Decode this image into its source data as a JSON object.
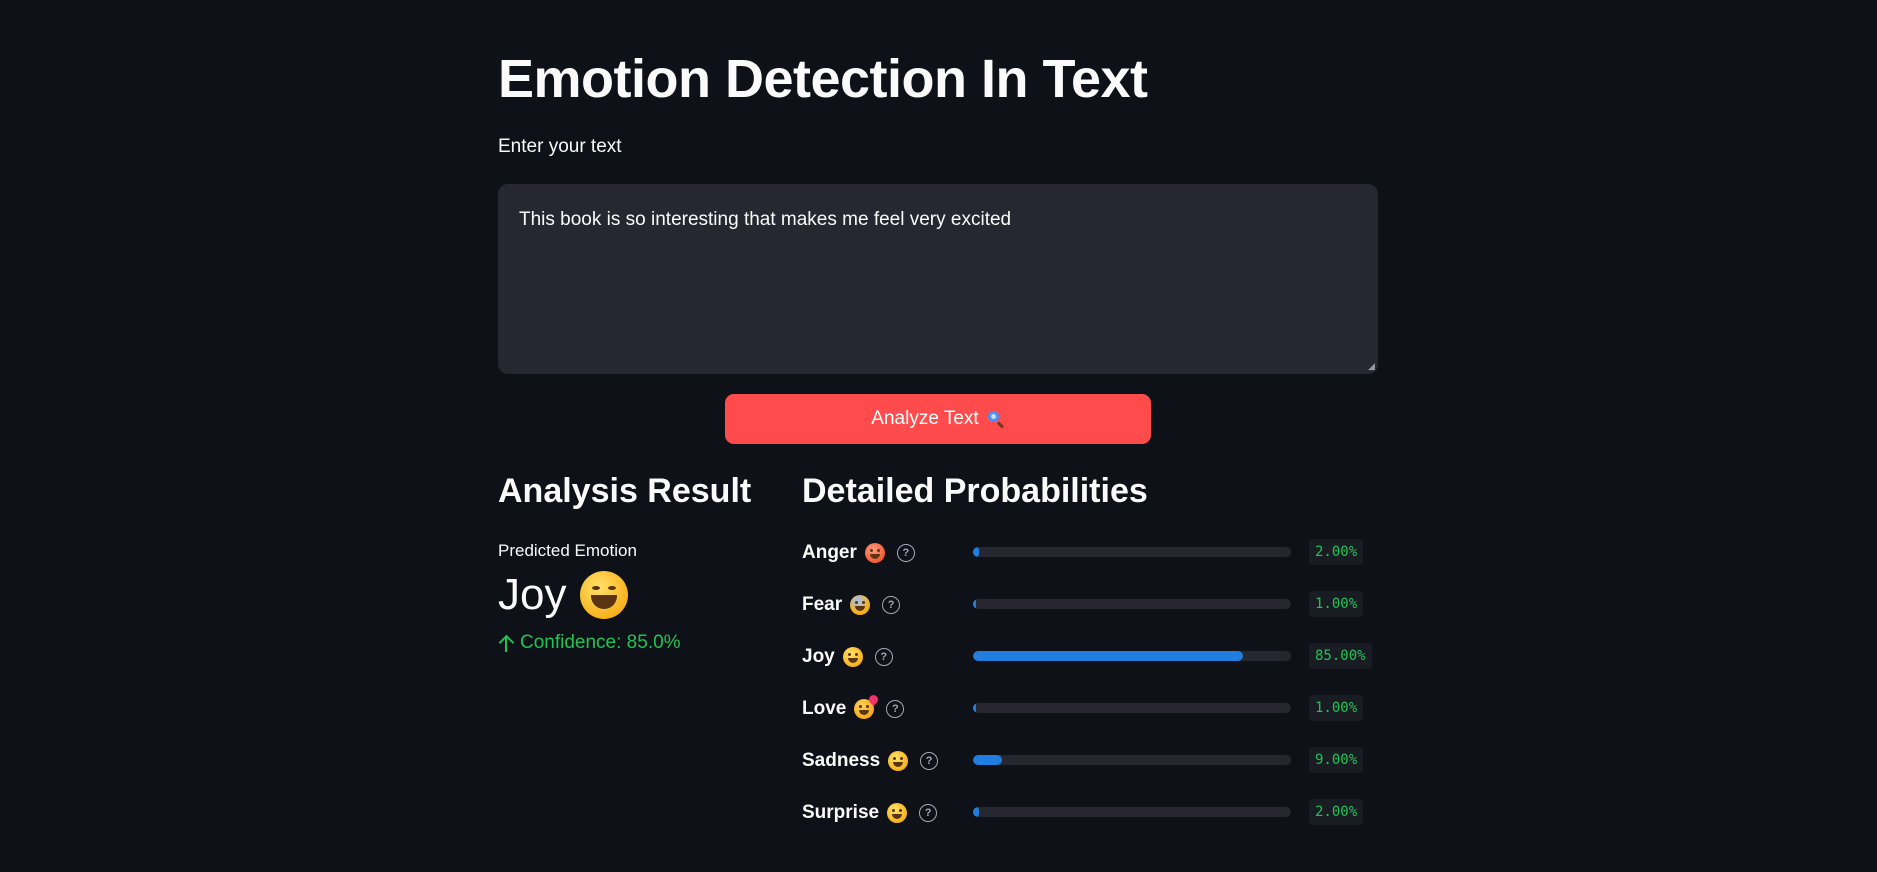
{
  "app": {
    "title": "Emotion Detection In Text"
  },
  "input": {
    "label": "Enter your text",
    "value": "This book is so interesting that makes me feel very excited"
  },
  "button": {
    "label": "Analyze Text",
    "icon": "magnifying-glass-icon",
    "color": "#ff4b4b"
  },
  "result": {
    "heading": "Analysis Result",
    "predicted_label": "Predicted Emotion",
    "predicted_emotion": "Joy",
    "predicted_emoji": "tears-of-joy-emoji",
    "confidence_text": "Confidence: 85.0%",
    "confidence_color": "#21c354"
  },
  "probabilities": {
    "heading": "Detailed Probabilities",
    "bar_color": "#1f7ee0",
    "items": [
      {
        "label": "Anger",
        "emoji": "angry-face-emoji",
        "value": 0.02,
        "text": "2.00%"
      },
      {
        "label": "Fear",
        "emoji": "screaming-face-emoji",
        "value": 0.01,
        "text": "1.00%"
      },
      {
        "label": "Joy",
        "emoji": "tears-of-joy-emoji",
        "value": 0.85,
        "text": "85.00%"
      },
      {
        "label": "Love",
        "emoji": "smiling-face-with-hearts-emoji",
        "value": 0.01,
        "text": "1.00%"
      },
      {
        "label": "Sadness",
        "emoji": "pensive-face-emoji",
        "value": 0.09,
        "text": "9.00%"
      },
      {
        "label": "Surprise",
        "emoji": "astonished-face-emoji",
        "value": 0.02,
        "text": "2.00%"
      }
    ]
  }
}
